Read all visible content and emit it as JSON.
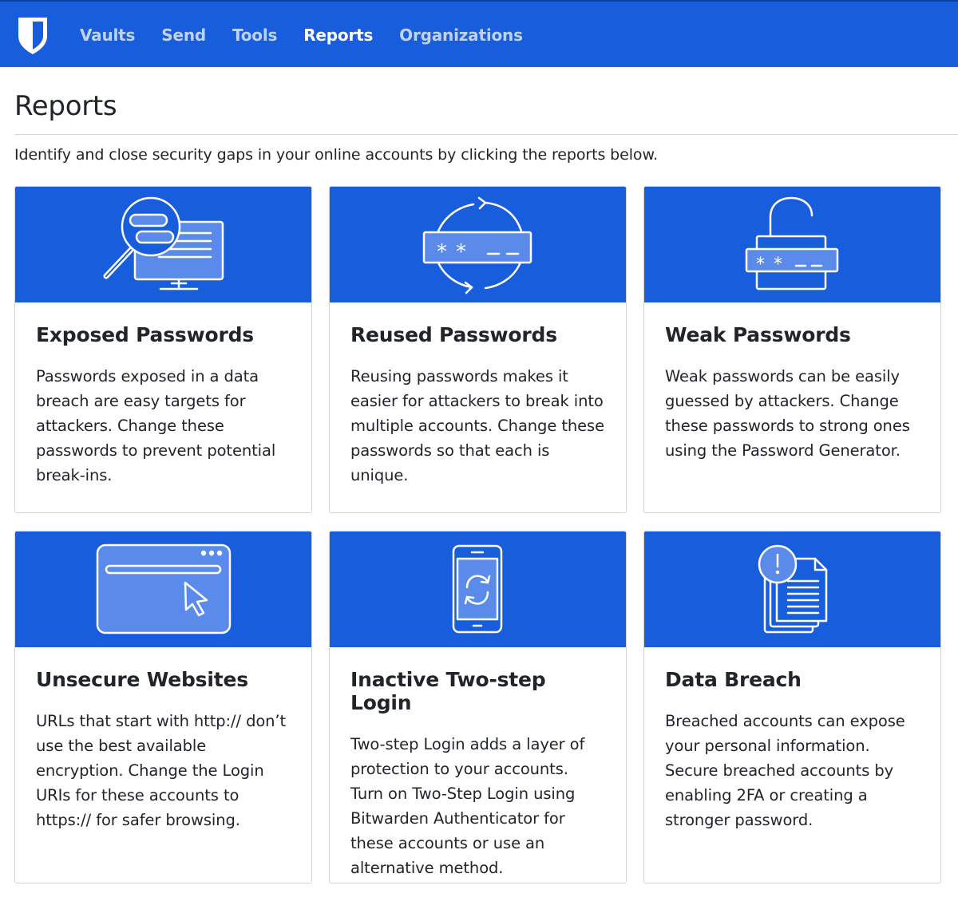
{
  "nav": {
    "items": [
      {
        "label": "Vaults",
        "active": false
      },
      {
        "label": "Send",
        "active": false
      },
      {
        "label": "Tools",
        "active": false
      },
      {
        "label": "Reports",
        "active": true
      },
      {
        "label": "Organizations",
        "active": false
      }
    ]
  },
  "colors": {
    "brand": "#175ddc",
    "card_border": "#cfd3d8",
    "text": "#212529"
  },
  "page": {
    "title": "Reports",
    "intro": "Identify and close security gaps in your online accounts by clicking the reports below."
  },
  "reports": [
    {
      "icon": "magnifier-monitor-icon",
      "title": "Exposed Passwords",
      "description": "Passwords exposed in a data breach are easy targets for attackers. Change these passwords to prevent potential break-ins."
    },
    {
      "icon": "recycle-password-icon",
      "title": "Reused Passwords",
      "description": "Reusing passwords makes it easier for attackers to break into multiple accounts. Change these passwords so that each is unique."
    },
    {
      "icon": "open-lock-password-icon",
      "title": "Weak Passwords",
      "description": "Weak passwords can be easily guessed by attackers. Change these passwords to strong ones using the Password Generator."
    },
    {
      "icon": "browser-cursor-icon",
      "title": "Unsecure Websites",
      "description": "URLs that start with http:// don’t use the best available encryption. Change the Login URIs for these accounts to https:// for safer browsing."
    },
    {
      "icon": "phone-sync-icon",
      "title": "Inactive Two-step Login",
      "description": "Two-step Login adds a layer of protection to your accounts. Turn on Two-Step Login using Bitwarden Authenticator for these accounts or use an alternative method."
    },
    {
      "icon": "documents-alert-icon",
      "title": "Data Breach",
      "description": "Breached accounts can expose your personal information. Secure breached accounts by enabling 2FA or creating a stronger password."
    }
  ]
}
